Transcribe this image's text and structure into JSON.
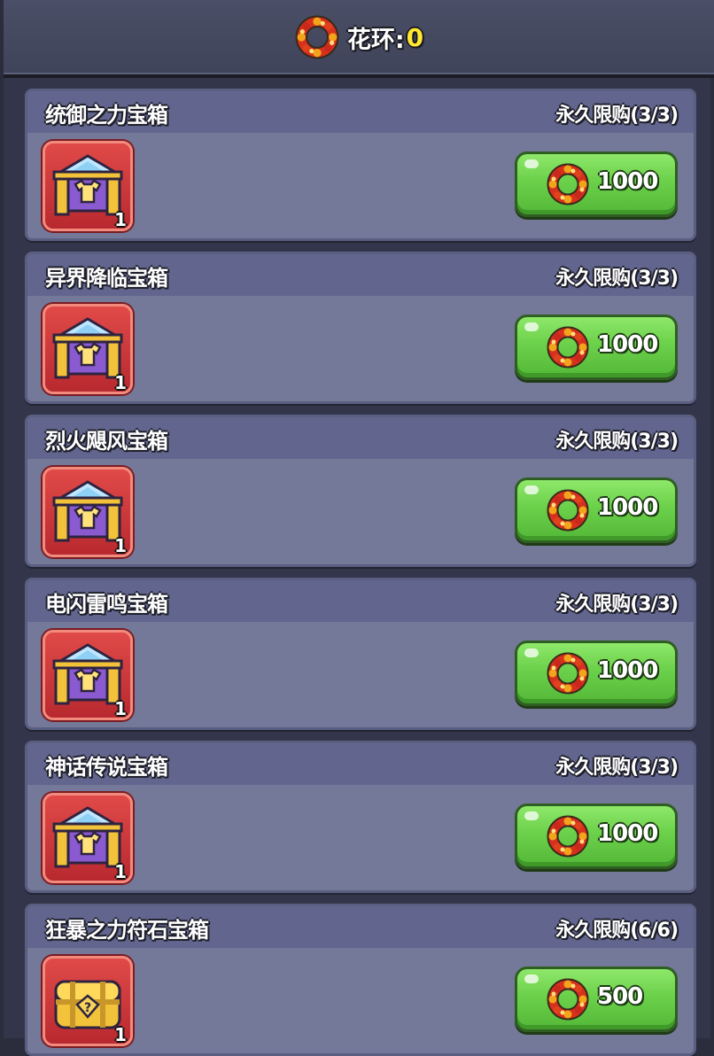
{
  "header": {
    "currency_icon": "wreath-icon",
    "currency_label": "花环:",
    "currency_value": "0"
  },
  "colors": {
    "button_green": "#6bd04a",
    "card_bg": "#747899",
    "card_header": "#62668e",
    "icon_red": "#e04a48",
    "currency_yellow": "#ffe830"
  },
  "items": [
    {
      "title": "统御之力宝箱",
      "limit": "永久限购(3/3)",
      "price": "1000",
      "icon": "clothing-chest-icon",
      "count": "1"
    },
    {
      "title": "异界降临宝箱",
      "limit": "永久限购(3/3)",
      "price": "1000",
      "icon": "clothing-chest-icon",
      "count": "1"
    },
    {
      "title": "烈火飓风宝箱",
      "limit": "永久限购(3/3)",
      "price": "1000",
      "icon": "clothing-chest-icon",
      "count": "1"
    },
    {
      "title": "电闪雷鸣宝箱",
      "limit": "永久限购(3/3)",
      "price": "1000",
      "icon": "clothing-chest-icon",
      "count": "1"
    },
    {
      "title": "神话传说宝箱",
      "limit": "永久限购(3/3)",
      "price": "1000",
      "icon": "clothing-chest-icon",
      "count": "1"
    },
    {
      "title": "狂暴之力符石宝箱",
      "limit": "永久限购(6/6)",
      "price": "500",
      "icon": "mystery-rune-chest-icon",
      "count": "1"
    }
  ]
}
